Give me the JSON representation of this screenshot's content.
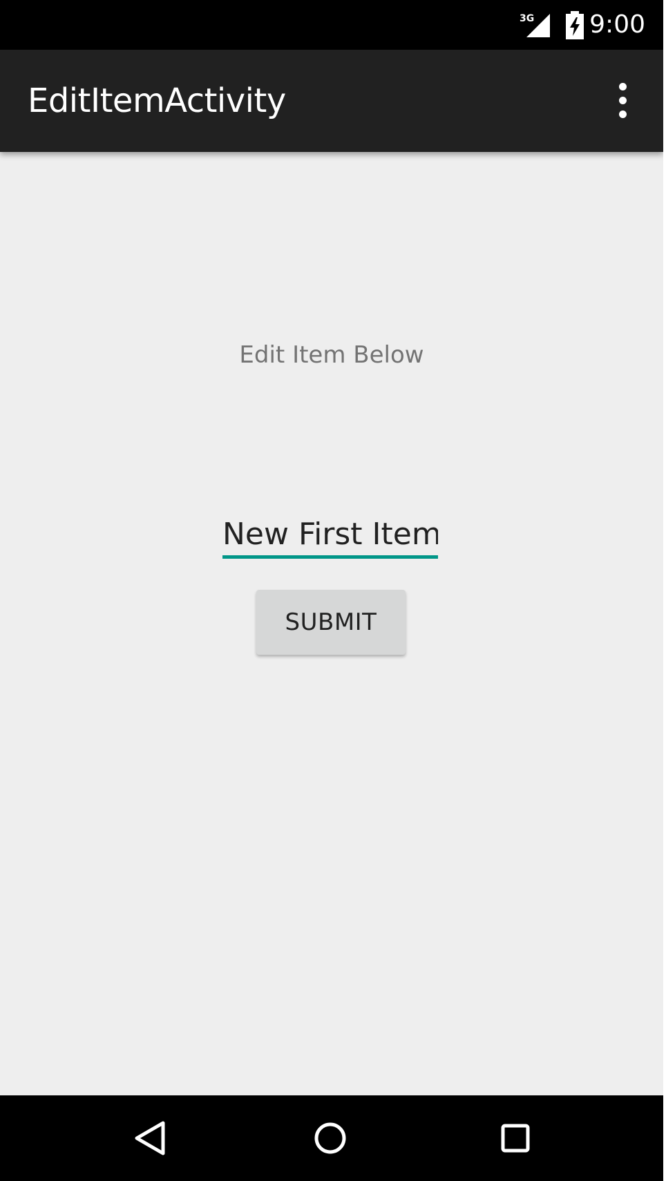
{
  "status_bar": {
    "network": "3G",
    "time": "9:00"
  },
  "app_bar": {
    "title": "EditItemActivity",
    "overflow_icon": "more-vert-icon"
  },
  "content": {
    "label": "Edit Item Below",
    "item_field": {
      "value": "New First Item",
      "underline_color": "#009688"
    },
    "submit_label": "SUBMIT"
  },
  "nav_bar": {
    "back_icon": "back-triangle-icon",
    "home_icon": "home-circle-icon",
    "recents_icon": "recents-square-icon"
  },
  "colors": {
    "status_bar": "#000000",
    "app_bar": "#212121",
    "background": "#eeeeee",
    "accent": "#009688",
    "button": "#d6d7d7"
  }
}
